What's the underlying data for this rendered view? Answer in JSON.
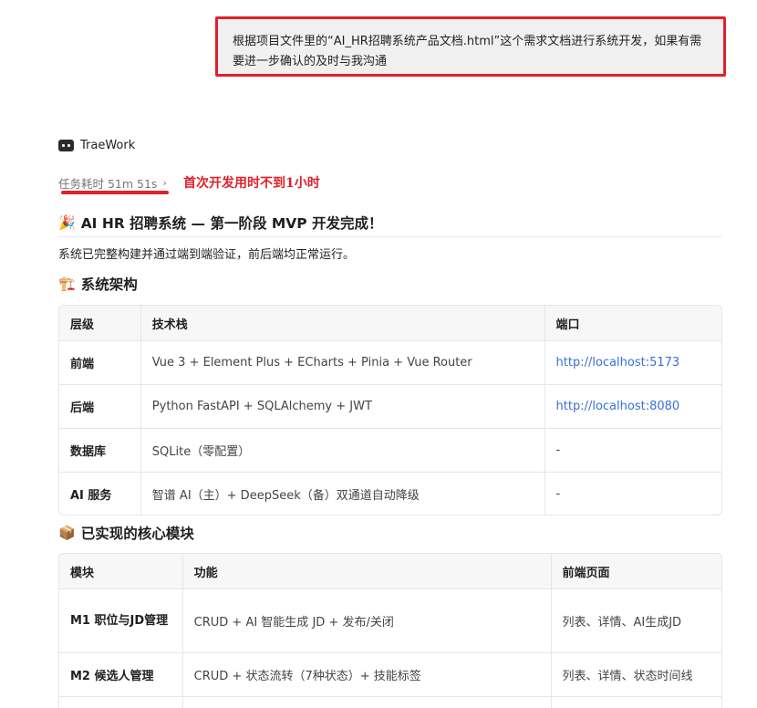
{
  "user_message": "根据项目文件里的“AI_HR招聘系统产品文档.html”这个需求文档进行系统开发，如果有需要进一步确认的及时与我沟通",
  "bot": {
    "name": "TraeWork",
    "icon": "chat-bot-icon"
  },
  "duration": {
    "label": "任务耗时 51m 51s",
    "chevron": "›"
  },
  "annotation": "首次开发用时不到1小时",
  "headline": {
    "emoji": "🎉",
    "text": "AI HR 招聘系统 — 第一阶段 MVP 开发完成！"
  },
  "intro": "系统已完整构建并通过端到端验证，前后端均正常运行。",
  "arch_section": {
    "emoji": "🏗️",
    "title": "系统架构",
    "headers": [
      "层级",
      "技术栈",
      "端口"
    ],
    "rows": [
      [
        "前端",
        "Vue 3 + Element Plus + ECharts + Pinia + Vue Router",
        "http://localhost:5173"
      ],
      [
        "后端",
        "Python FastAPI + SQLAlchemy + JWT",
        "http://localhost:8080"
      ],
      [
        "数据库",
        "SQLite（零配置）",
        "-"
      ],
      [
        "AI 服务",
        "智谱 AI（主）+ DeepSeek（备）双通道自动降级",
        "-"
      ]
    ]
  },
  "modules_section": {
    "emoji": "📦",
    "title": "已实现的核心模块",
    "headers": [
      "模块",
      "功能",
      "前端页面"
    ],
    "rows": [
      [
        "M1 职位与JD管理",
        "CRUD + AI 智能生成 JD + 发布/关闭",
        "列表、详情、AI生成JD"
      ],
      [
        "M2 候选人管理",
        "CRUD + 状态流转（7种状态）+ 技能标签",
        "列表、详情、状态时间线"
      ]
    ]
  },
  "colors": {
    "accent_red": "#e0202a",
    "link": "#3a6fd8"
  }
}
